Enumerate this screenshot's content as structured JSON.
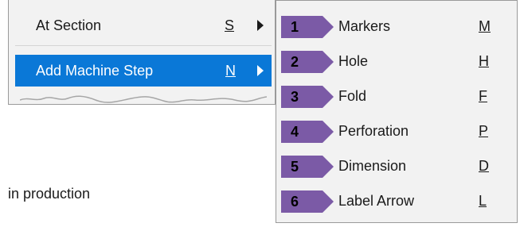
{
  "parent_menu": {
    "items": [
      {
        "label": "At Section",
        "shortcut": "S",
        "has_submenu": true,
        "selected": false
      },
      {
        "label": "Add Machine Step",
        "shortcut": "N",
        "has_submenu": true,
        "selected": true
      }
    ],
    "selected_color": "#0a78d7"
  },
  "background_text": "in production",
  "submenu": {
    "badge_color": "#7b5aa6",
    "items": [
      {
        "number": "1",
        "label": "Markers",
        "shortcut": "M"
      },
      {
        "number": "2",
        "label": "Hole",
        "shortcut": "H"
      },
      {
        "number": "3",
        "label": "Fold",
        "shortcut": "F"
      },
      {
        "number": "4",
        "label": "Perforation",
        "shortcut": "P"
      },
      {
        "number": "5",
        "label": "Dimension",
        "shortcut": "D"
      },
      {
        "number": "6",
        "label": "Label Arrow",
        "shortcut": "L"
      }
    ]
  }
}
